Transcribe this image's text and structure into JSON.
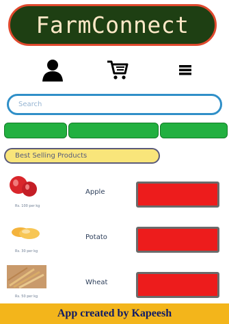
{
  "app": {
    "title": "FarmConnect"
  },
  "nav": {
    "icons": [
      "user-icon",
      "cart-icon",
      "menu-icon"
    ]
  },
  "search": {
    "placeholder": "Search"
  },
  "tabs": [
    {
      "label": ""
    },
    {
      "label": ""
    },
    {
      "label": ""
    }
  ],
  "section": {
    "label": "Best Selling Products"
  },
  "products": [
    {
      "name": "Apple",
      "price": "Rs. 100 per kg",
      "button_label": ""
    },
    {
      "name": "Potato",
      "price": "Rs. 30 per kg",
      "button_label": ""
    },
    {
      "name": "Wheat",
      "price": "Rs. 50 per kg",
      "button_label": ""
    }
  ],
  "footer": {
    "text": "App created by Kapeesh"
  },
  "colors": {
    "header_bg": "#1e3f13",
    "header_border": "#e0492e",
    "tab_green": "#22b040",
    "buy_red": "#ed1c1c",
    "section_yellow": "#f9e57a",
    "footer_bg": "#f3b51b",
    "footer_text": "#0e1a66"
  }
}
